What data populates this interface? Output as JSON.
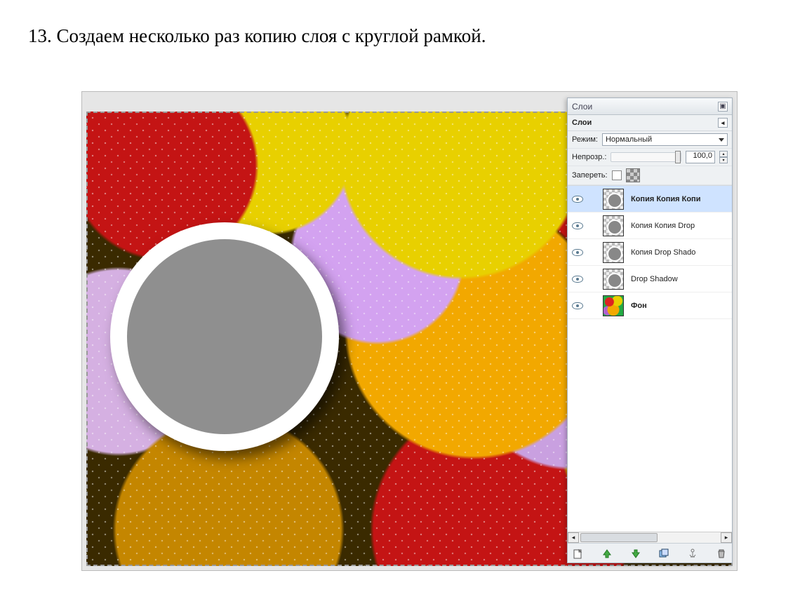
{
  "instruction": "13. Создаем несколько раз копию слоя с круглой рамкой.",
  "dock": {
    "title": "Слои",
    "section_label": "Слои",
    "mode_label": "Режим:",
    "mode_value": "Нормальный",
    "opacity_label": "Непрозр.:",
    "opacity_value": "100,0",
    "lock_label": "Запереть:"
  },
  "layers": [
    {
      "name": "Копия Копия Копи",
      "kind": "ring",
      "selected": true
    },
    {
      "name": "Копия Копия Drop",
      "kind": "ring",
      "selected": false
    },
    {
      "name": "Копия Drop Shado",
      "kind": "ring",
      "selected": false
    },
    {
      "name": "Drop Shadow",
      "kind": "ring",
      "selected": false
    },
    {
      "name": "Фон",
      "kind": "bg",
      "selected": false
    }
  ],
  "toolbar_icons": {
    "new": "new-layer-icon",
    "up": "raise-layer-icon",
    "down": "lower-layer-icon",
    "dup": "duplicate-layer-icon",
    "anchor": "anchor-layer-icon",
    "del": "delete-layer-icon"
  }
}
